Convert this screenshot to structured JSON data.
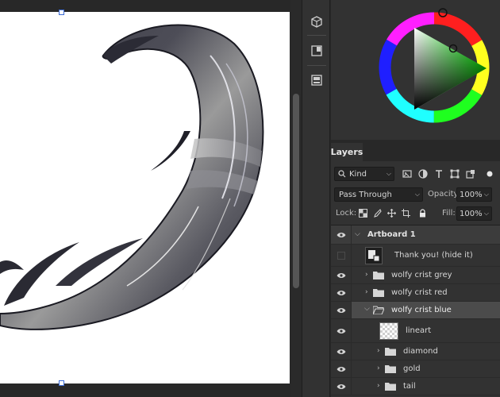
{
  "layers_panel": {
    "tab_label": "Layers",
    "filter_kind": "Kind",
    "blend_mode": "Pass Through",
    "opacity_label": "Opacity:",
    "opacity_value": "100%",
    "lock_label": "Lock:",
    "fill_label": "Fill:",
    "fill_value": "100%",
    "layers": [
      {
        "name": "Artboard 1",
        "type": "artboard",
        "visible": true,
        "expanded": true
      },
      {
        "name": "Thank you! (hide it)",
        "type": "smart-object",
        "visible": false
      },
      {
        "name": "wolfy crist grey",
        "type": "group",
        "visible": true,
        "expanded": false
      },
      {
        "name": "wolfy crist red",
        "type": "group",
        "visible": true,
        "expanded": false
      },
      {
        "name": "wolfy crist blue",
        "type": "group",
        "visible": true,
        "expanded": true,
        "selected": true
      },
      {
        "name": "lineart",
        "type": "pixel",
        "visible": true
      },
      {
        "name": "diamond",
        "type": "group",
        "visible": true,
        "expanded": false
      },
      {
        "name": "gold",
        "type": "group",
        "visible": true,
        "expanded": false
      },
      {
        "name": "tail",
        "type": "group",
        "visible": true,
        "expanded": false
      }
    ]
  },
  "colors": {
    "panel_bg": "#323232",
    "dark_bg": "#282828",
    "selected_row": "#4b4b4b",
    "accent": "#3b6bd6"
  }
}
